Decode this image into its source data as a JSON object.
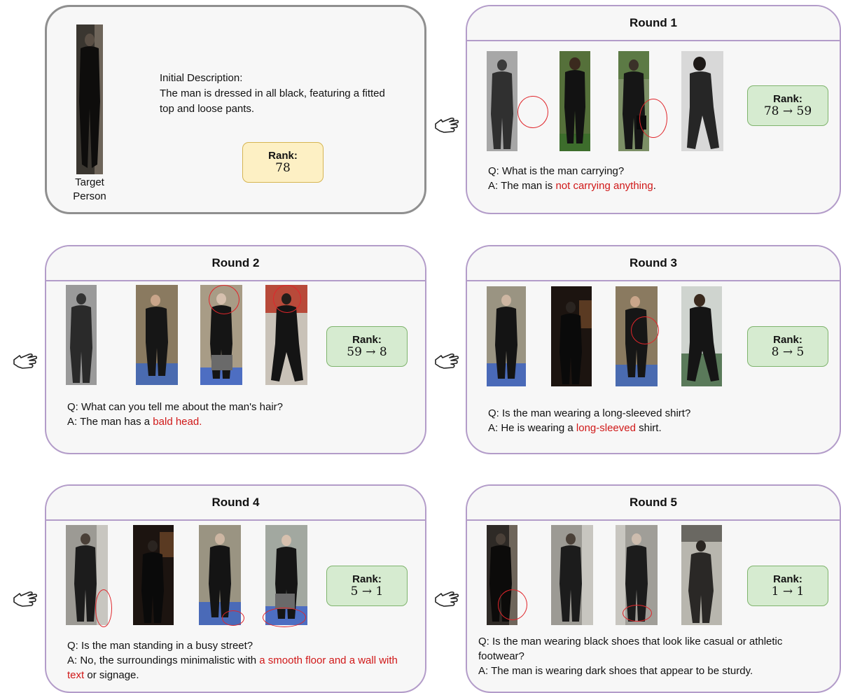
{
  "intro": {
    "caption_line1": "Target",
    "caption_line2": "Person",
    "description_label": "Initial Description:",
    "description_text": "The man is dressed in all black, featuring a fitted top and loose pants.",
    "rank_label": "Rank:",
    "rank_value": "78"
  },
  "rounds": [
    {
      "title": "Round 1",
      "rank_label": "Rank:",
      "rank_value": "78 → 59",
      "question": "Q: What is the man carrying?",
      "answer_pre": "A: The man is ",
      "answer_hl": "not carrying anything",
      "answer_post": "."
    },
    {
      "title": "Round 2",
      "rank_label": "Rank:",
      "rank_value": "59 → 8",
      "question": "Q: What can you tell me about the man's hair?",
      "answer_pre": "A: The man has a ",
      "answer_hl": "bald head.",
      "answer_post": ""
    },
    {
      "title": "Round 3",
      "rank_label": "Rank:",
      "rank_value": "8 → 5",
      "question": "Q: Is the man wearing a long-sleeved shirt?",
      "answer_pre": "A: He is wearing a ",
      "answer_hl": "long-sleeved",
      "answer_post": " shirt."
    },
    {
      "title": "Round 4",
      "rank_label": "Rank:",
      "rank_value": "5 → 1",
      "question": "Q: Is the man standing in a busy street?",
      "answer_pre": "A: No, the surroundings minimalistic with ",
      "answer_hl": "a smooth floor and a wall with text",
      "answer_post": " or signage."
    },
    {
      "title": "Round 5",
      "rank_label": "Rank:",
      "rank_value": "1 → 1",
      "question": "Q: Is the man wearing black shoes that look like casual or athletic footwear?",
      "answer_pre": "A: The man is wearing dark shoes that appear to be sturdy.",
      "answer_hl": "",
      "answer_post": ""
    }
  ],
  "colors": {
    "highlight": "#d01818",
    "rank_green": "#d6ebd0",
    "rank_yellow": "#fdf0c4",
    "panel_border": "#b39cc9",
    "circle": "#e0262b"
  },
  "icons": [
    "pointing-hand-icon"
  ]
}
